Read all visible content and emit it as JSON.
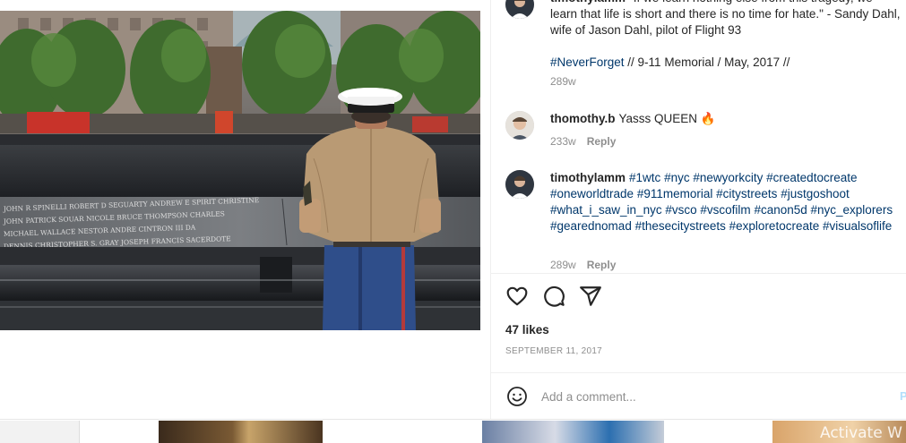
{
  "comments": [
    {
      "id": "caption",
      "user": "timothylamm",
      "text": "\"If we learn nothing else from this tragedy, we learn that life is short and there is no time for hate.\" - Sandy Dahl, wife of Jason Dahl, pilot of Flight 93",
      "hashtag": "#NeverForget",
      "text_after": " // 9-11 Memorial / May, 2017 //",
      "time": "289w"
    },
    {
      "id": "reply1",
      "user": "thomothy.b",
      "text": "Yasss QUEEN",
      "emoji": "🔥",
      "time": "233w",
      "reply_label": "Reply"
    },
    {
      "id": "hashtags",
      "user": "timothylamm",
      "hashtags": [
        "#1wtc",
        "#nyc",
        "#newyorkcity",
        "#createdtocreate",
        "#oneworldtrade",
        "#911memorial",
        "#citystreets",
        "#justgoshoot",
        "#what_i_saw_in_nyc",
        "#vsco",
        "#vscofilm",
        "#canon5d",
        "#nyc_explorers",
        "#gearednomad",
        "#thesecitystreets",
        "#exploretocreate",
        "#visualsoflife"
      ],
      "time": "289w",
      "reply_label": "Reply"
    }
  ],
  "actions": {
    "like_icon": "heart-icon",
    "comment_icon": "speech-bubble-icon",
    "share_icon": "paper-plane-icon"
  },
  "likes": "47 likes",
  "date": "SEPTEMBER 11, 2017",
  "add_comment": {
    "placeholder": "Add a comment...",
    "post_label": "P"
  },
  "watermark": "Activate W",
  "colors": {
    "link": "#00376b",
    "muted": "#8e8e8e",
    "text": "#262626",
    "post_disabled": "#b2dffc"
  }
}
